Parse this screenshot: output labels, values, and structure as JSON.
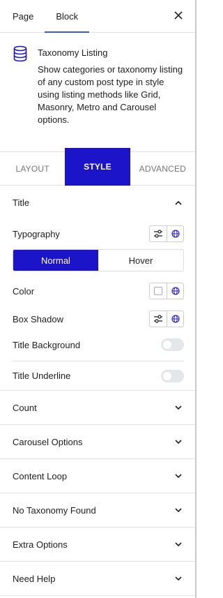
{
  "header": {
    "tabs": [
      {
        "label": "Page"
      },
      {
        "label": "Block"
      }
    ],
    "close_label": "×"
  },
  "block": {
    "icon": "database-icon",
    "title": "Taxonomy Listing",
    "description": "Show categories or taxonomy listing of any custom post type in style using listing methods like Grid, Masonry, Metro and Carousel options."
  },
  "style_tabs": [
    {
      "label": "LAYOUT"
    },
    {
      "label": "STYLE"
    },
    {
      "label": "ADVANCED"
    }
  ],
  "title_section": {
    "label": "Title",
    "typography_label": "Typography",
    "state_tabs": [
      {
        "label": "Normal"
      },
      {
        "label": "Hover"
      }
    ],
    "color_label": "Color",
    "box_shadow_label": "Box Shadow",
    "title_background_label": "Title Background",
    "title_underline_label": "Title Underline"
  },
  "sections": [
    {
      "label": "Count"
    },
    {
      "label": "Carousel Options"
    },
    {
      "label": "Content Loop"
    },
    {
      "label": "No Taxonomy Found"
    },
    {
      "label": "Extra Options"
    },
    {
      "label": "Need Help"
    }
  ],
  "colors": {
    "accent": "#1c14c9",
    "tab_underline": "#3858e9"
  }
}
